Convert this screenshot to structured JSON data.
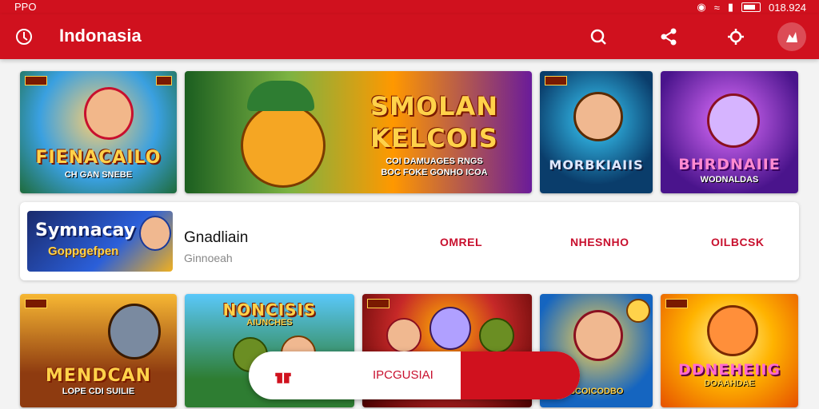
{
  "status": {
    "carrier": "PPO",
    "time": "018.924"
  },
  "appbar": {
    "title": "Indonasia"
  },
  "row1": [
    {
      "title": "FIENACAILO",
      "subtitle": "CH GAN SNEBE"
    },
    {
      "title": "SMOLAN KELCOIS",
      "subtitle": "COI DAMUAGES RNGS\nBOC FOKE GONHO ICOA"
    },
    {
      "title": "MORBKIAIIS",
      "subtitle": ""
    },
    {
      "title": "BHRDNAIIE",
      "subtitle": "WODNALDAS"
    }
  ],
  "featured": {
    "thumb_title": "Symnacay",
    "thumb_sub": "Goppgefpen",
    "name": "Gnadliain",
    "meta": "Ginnoeah",
    "actions": [
      "OMREL",
      "NHESNHO",
      "OILBCSK"
    ]
  },
  "row2": [
    {
      "title": "MENDCAN",
      "subtitle": "LOPE CDI SUILIE"
    },
    {
      "title": "NONCISIS",
      "subtitle": "AIUNCHES"
    },
    {
      "title": "",
      "subtitle": ""
    },
    {
      "title": "",
      "subtitle": "SCOICODBO"
    },
    {
      "title": "DDNEHEIIG",
      "subtitle": "DOAAHDAE"
    }
  ],
  "bottom": {
    "label": "IPCGUSIAI"
  },
  "colors": {
    "primary": "#d0111e",
    "accent": "#c8102e"
  }
}
